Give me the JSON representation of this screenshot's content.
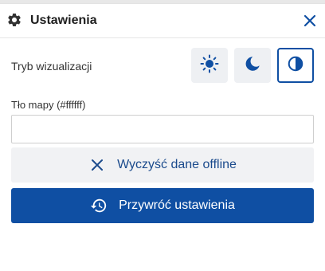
{
  "header": {
    "title": "Ustawienia",
    "icon": "gear-icon",
    "close_icon": "close-icon"
  },
  "display_mode": {
    "label": "Tryb wizualizacji",
    "options": [
      {
        "name": "light",
        "icon": "sun-icon",
        "active": false
      },
      {
        "name": "dark",
        "icon": "moon-icon",
        "active": false
      },
      {
        "name": "contrast",
        "icon": "contrast-icon",
        "active": true
      }
    ]
  },
  "map_background": {
    "label": "Tło mapy (#ffffff)",
    "value": "",
    "placeholder": ""
  },
  "actions": {
    "clear_offline_label": "Wyczyść dane offline",
    "reset_settings_label": "Przywróć ustawienia"
  },
  "colors": {
    "accent": "#0f4fa3",
    "secondary_button_bg": "#f1f2f4"
  }
}
